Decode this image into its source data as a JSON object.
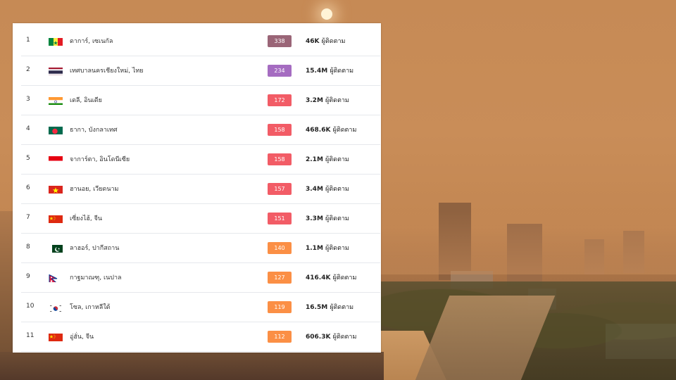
{
  "colors": {
    "hazardous": "#9a6577",
    "very_unhealthy": "#a56cc1",
    "unhealthy": "#f25c66",
    "unhealthy_sensitive": "#fb8f45"
  },
  "rows": [
    {
      "rank": "1",
      "city": "ดาการ์, เซเนกัล",
      "flag": "senegal",
      "aqi": "338",
      "aqi_color": "#9a6577",
      "followers": "46K",
      "followers_label": "ผู้ติดตาม"
    },
    {
      "rank": "2",
      "city": "เทศบาลนครเชียงใหม่, ไทย",
      "flag": "thailand",
      "aqi": "234",
      "aqi_color": "#a56cc1",
      "followers": "15.4M",
      "followers_label": "ผู้ติดตาม"
    },
    {
      "rank": "3",
      "city": "เดลี, อินเดีย",
      "flag": "india",
      "aqi": "172",
      "aqi_color": "#f25c66",
      "followers": "3.2M",
      "followers_label": "ผู้ติดตาม"
    },
    {
      "rank": "4",
      "city": "ธากา, บังกลาเทศ",
      "flag": "bangladesh",
      "aqi": "158",
      "aqi_color": "#f25c66",
      "followers": "468.6K",
      "followers_label": "ผู้ติดตาม"
    },
    {
      "rank": "5",
      "city": "จาการ์ตา, อินโดนีเซีย",
      "flag": "indonesia",
      "aqi": "158",
      "aqi_color": "#f25c66",
      "followers": "2.1M",
      "followers_label": "ผู้ติดตาม"
    },
    {
      "rank": "6",
      "city": "ฮานอย, เวียดนาม",
      "flag": "vietnam",
      "aqi": "157",
      "aqi_color": "#f25c66",
      "followers": "3.4M",
      "followers_label": "ผู้ติดตาม"
    },
    {
      "rank": "7",
      "city": "เซี่ยงไฮ้, จีน",
      "flag": "china",
      "aqi": "151",
      "aqi_color": "#f25c66",
      "followers": "3.3M",
      "followers_label": "ผู้ติดตาม"
    },
    {
      "rank": "8",
      "city": "ลาฮอร์, ปากีสถาน",
      "flag": "pakistan",
      "aqi": "140",
      "aqi_color": "#fb8f45",
      "followers": "1.1M",
      "followers_label": "ผู้ติดตาม"
    },
    {
      "rank": "9",
      "city": "กาฐมาณฑุ, เนปาล",
      "flag": "nepal",
      "aqi": "127",
      "aqi_color": "#fb8f45",
      "followers": "416.4K",
      "followers_label": "ผู้ติดตาม"
    },
    {
      "rank": "10",
      "city": "โซล, เกาหลีใต้",
      "flag": "south-korea",
      "aqi": "119",
      "aqi_color": "#fb8f45",
      "followers": "16.5M",
      "followers_label": "ผู้ติดตาม"
    },
    {
      "rank": "11",
      "city": "อู่ฮั่น, จีน",
      "flag": "china",
      "aqi": "112",
      "aqi_color": "#fb8f45",
      "followers": "606.3K",
      "followers_label": "ผู้ติดตาม"
    }
  ]
}
